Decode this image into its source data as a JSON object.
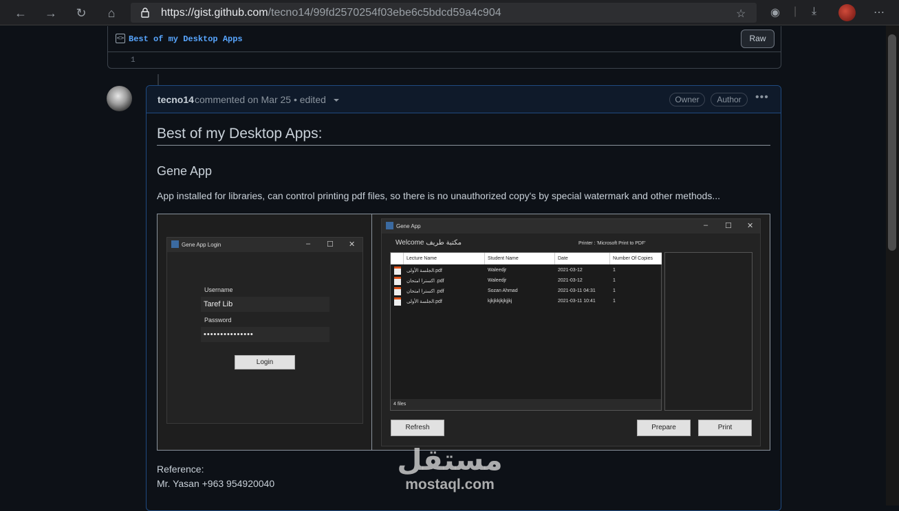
{
  "browser": {
    "url_host": "https://gist.github.com",
    "url_path": "/tecno14/99fd2570254f03ebe6c5bdcd59a4c904"
  },
  "file": {
    "name": "Best of my Desktop Apps",
    "raw_label": "Raw",
    "line_number": "1"
  },
  "comment": {
    "author": "tecno14",
    "meta": "commented on Mar 25 • edited",
    "badge_owner": "Owner",
    "badge_author": "Author",
    "more_label": "•••",
    "heading": "Best of my Desktop Apps:",
    "subheading": "Gene App",
    "description": "App installed for libraries, can control printing pdf files, so there is no unauthorized copy's by special watermark and other methods...",
    "reference_label": "Reference:",
    "reference_value": "Mr. Yasan +963 954920040"
  },
  "login_window": {
    "title": "Gene App Login",
    "username_label": "Username",
    "username_value": "Taref Lib",
    "password_label": "Password",
    "password_value": "•••••••••••••••",
    "login_button": "Login"
  },
  "main_window": {
    "title": "Gene App",
    "welcome": "Welcome مكتبة طريف",
    "printer": "Printer : 'Microsoft Print to PDF'",
    "columns": [
      "Lecture Name",
      "Student Name",
      "Date",
      "Number Of Copies"
    ],
    "rows": [
      [
        "الجلسة الأولى.pdf",
        "Waleedjr",
        "2021-03-12",
        "1"
      ],
      [
        "اكسترا امتحان .pdf",
        "Waleedjr",
        "2021-03-12",
        "1"
      ],
      [
        "اكسترا امتحان .pdf",
        "Sozan Ahmad",
        "2021-03-11 04:31",
        "1"
      ],
      [
        "الجلسة الأولى.pdf",
        "kjkjkkjkjkjjkj",
        "2021-03-11 10:41",
        "1"
      ]
    ],
    "status": "4 files",
    "refresh_button": "Refresh",
    "prepare_button": "Prepare",
    "print_button": "Print"
  },
  "watermark": {
    "arabic": "مستقل",
    "latin": "mostaql.com"
  }
}
